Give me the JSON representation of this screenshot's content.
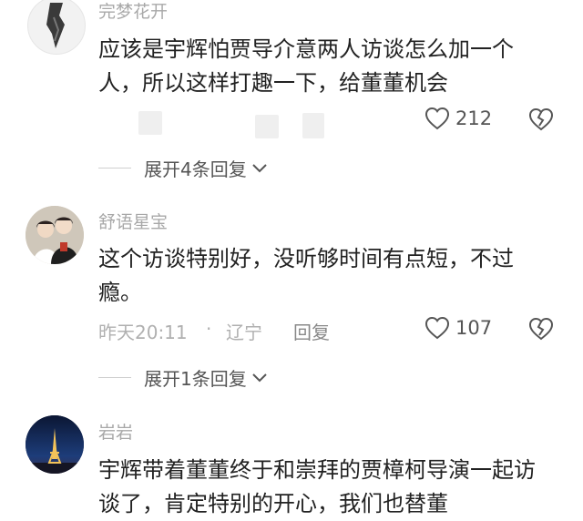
{
  "comments": [
    {
      "username": "完梦花开",
      "text": "应该是宇辉怕贾导介意两人访谈怎么加一个人，所以这样打趣一下，给董董机会",
      "likes": "212",
      "expand_label": "展开4条回复"
    },
    {
      "username": "舒语星宝",
      "text": "这个访谈特别好，没听够时间有点短，不过瘾。",
      "time": "昨天20:11",
      "separator": "·",
      "location": "辽宁",
      "reply_label": "回复",
      "likes": "107",
      "expand_label": "展开1条回复"
    },
    {
      "username": "岩岩",
      "text": "宇辉带着董董终于和崇拜的贾樟柯导演一起访谈了，肯定特别的开心，我们也替董"
    }
  ],
  "icons": {
    "like": "heart-outline-icon",
    "dislike": "broken-heart-icon",
    "expand": "chevron-down-icon"
  },
  "colors": {
    "text": "#222222",
    "secondary": "#a8a8a8",
    "divider": "#cfcfcf"
  }
}
